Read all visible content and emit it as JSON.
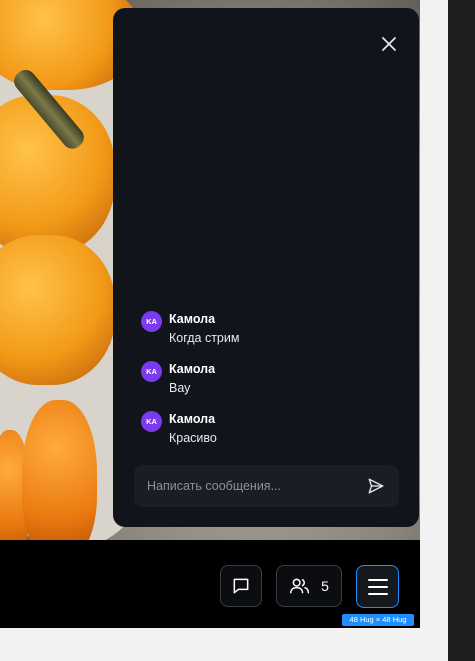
{
  "chat": {
    "input_placeholder": "Написать сообщения...",
    "messages": [
      {
        "avatar": "KA",
        "name": "Камола",
        "text": "Когда стрим"
      },
      {
        "avatar": "KA",
        "name": "Камола",
        "text": "Вау"
      },
      {
        "avatar": "KA",
        "name": "Камола",
        "text": "Красиво"
      }
    ]
  },
  "controls": {
    "viewer_count": "5",
    "size_label": "48 Hug × 48 Hug"
  },
  "colors": {
    "avatar": "#7c3aed",
    "panel": "#11141b",
    "selection": "#1f8fff"
  },
  "icons": [
    "close-icon",
    "send-icon",
    "chat-icon",
    "users-icon",
    "menu-icon"
  ]
}
